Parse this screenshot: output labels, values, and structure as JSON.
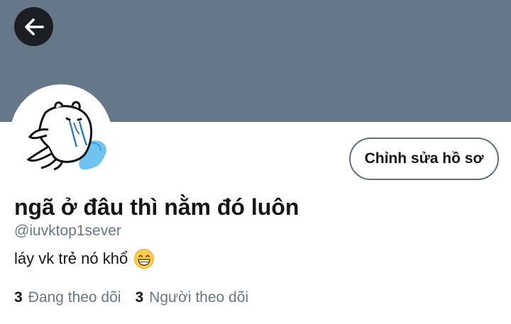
{
  "profile": {
    "display_name": "ngã ở đâu thì nằm đó luôn",
    "handle": "@iuvktop1sever",
    "bio": "láy vk trẻ nó khổ",
    "bio_emoji": "grinning-face-icon",
    "edit_button": "Chỉnh sửa hồ sơ",
    "following_count": "3",
    "following_label": "Đang theo dõi",
    "followers_count": "3",
    "followers_label": "Người theo dõi"
  },
  "icons": {
    "back": "arrow-left-icon",
    "avatar": "cartoon-bear-lying-avatar"
  },
  "colors": {
    "banner": "#667789",
    "text_primary": "#14171a",
    "text_secondary": "#657786",
    "button_border": "#5f6f7d"
  }
}
